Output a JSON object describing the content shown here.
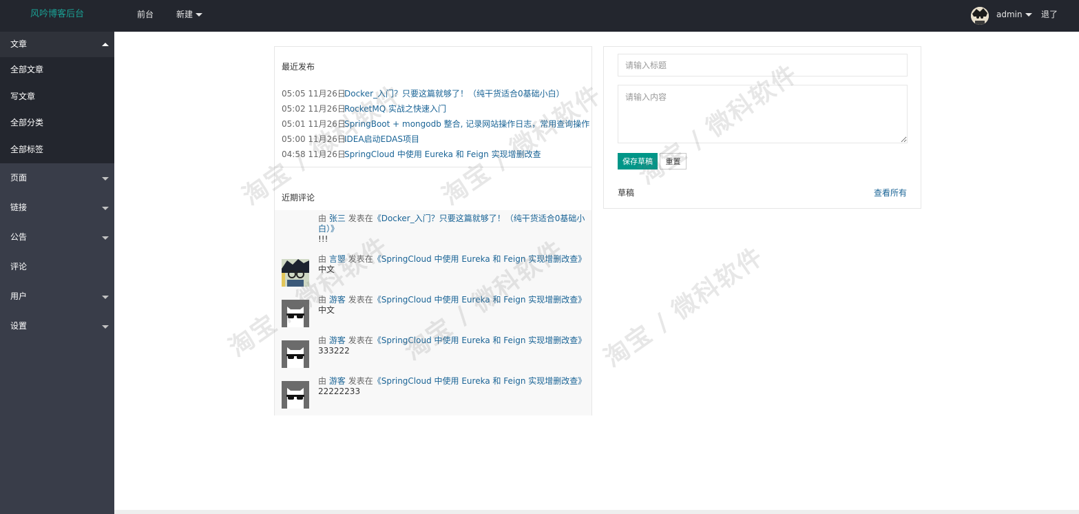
{
  "header": {
    "brand": "风吟博客后台",
    "nav": [
      {
        "label": "前台"
      },
      {
        "label": "新建"
      }
    ],
    "user": "admin",
    "logout": "退了"
  },
  "sidebar": {
    "groups": [
      {
        "label": "文章",
        "expanded": true,
        "items": [
          "全部文章",
          "写文章",
          "全部分类",
          "全部标签"
        ]
      },
      {
        "label": "页面",
        "expanded": false
      },
      {
        "label": "链接",
        "expanded": false
      },
      {
        "label": "公告",
        "expanded": false
      },
      {
        "label": "评论",
        "expanded": false
      },
      {
        "label": "用户",
        "expanded": false
      },
      {
        "label": "设置",
        "expanded": false
      }
    ]
  },
  "recent_posts": {
    "title": "最近发布",
    "items": [
      {
        "time": "05:05 11月26日",
        "title": "Docker_入门？只要这篇就够了！（纯干货适合0基础小白）"
      },
      {
        "time": "05:02 11月26日",
        "title": "RocketMQ 实战之快速入门"
      },
      {
        "time": "05:01 11月26日",
        "title": "SpringBoot + mongodb 整合, 记录网站操作日志，常用查询操作"
      },
      {
        "time": "05:00 11月26日",
        "title": "IDEA启动EDAS项目"
      },
      {
        "time": "04:58 11月26日",
        "title": "SpringCloud 中使用 Eureka 和 Feign 实现增删改查"
      }
    ]
  },
  "recent_comments": {
    "title": "近期评论",
    "by": "由",
    "posted_in": "发表在",
    "items": [
      {
        "user": "张三",
        "post": "《Docker_入门？只要这篇就够了！（纯干货适合0基础小白）》",
        "body": "!!!",
        "avatar": "none"
      },
      {
        "user": "言曌",
        "post": "《SpringCloud 中使用 Eureka 和 Feign 实现增删改查》",
        "body": "中文",
        "avatar": "anime-avatar"
      },
      {
        "user": "游客",
        "post": "《SpringCloud 中使用 Eureka 和 Feign 实现增删改查》",
        "body": "中文",
        "avatar": "sunglasses-cat"
      },
      {
        "user": "游客",
        "post": "《SpringCloud 中使用 Eureka 和 Feign 实现增删改查》",
        "body": "333222",
        "avatar": "sunglasses-cat"
      },
      {
        "user": "游客",
        "post": "《SpringCloud 中使用 Eureka 和 Feign 实现增删改查》",
        "body": "22222233",
        "avatar": "sunglasses-cat"
      }
    ]
  },
  "quick_draft": {
    "title_placeholder": "请输入标题",
    "body_placeholder": "请输入内容",
    "save_label": "保存草稿",
    "reset_label": "重置",
    "drafts_label": "草稿",
    "view_all": "查看所有"
  },
  "watermark": "淘宝 / 微科软件",
  "colors": {
    "topbar": "#23262e",
    "sidebar": "#393d49",
    "brand": "#1aa094",
    "primary_button": "#009688",
    "link": "#1a6496"
  }
}
